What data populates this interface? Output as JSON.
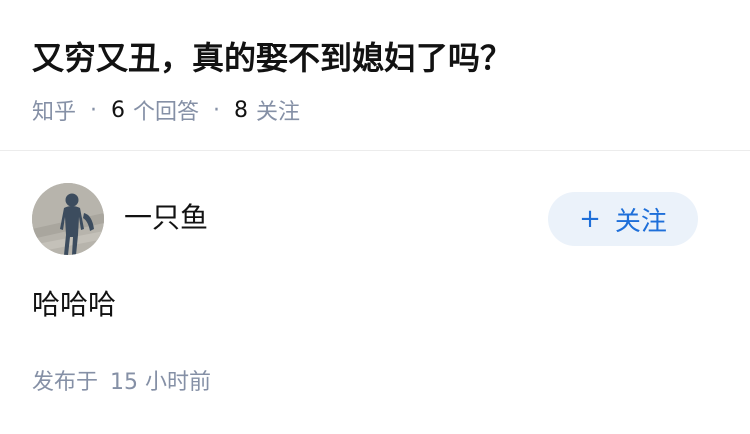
{
  "question": {
    "title": "又穷又丑，真的娶不到媳妇了吗？",
    "source": "知乎",
    "answer_count": "6",
    "answer_label": "个回答",
    "follower_count": "8",
    "follower_label": "关注",
    "separator": "·"
  },
  "answer": {
    "author_name": "一只鱼",
    "follow_plus": "+",
    "follow_label": "关注",
    "content": "哈哈哈",
    "publish_prefix": "发布于",
    "publish_time": "15 小时前"
  },
  "colors": {
    "accent": "#1e6fd9",
    "button_bg": "#ebf2fa",
    "meta_gray": "#8590a6",
    "text": "#121212"
  }
}
